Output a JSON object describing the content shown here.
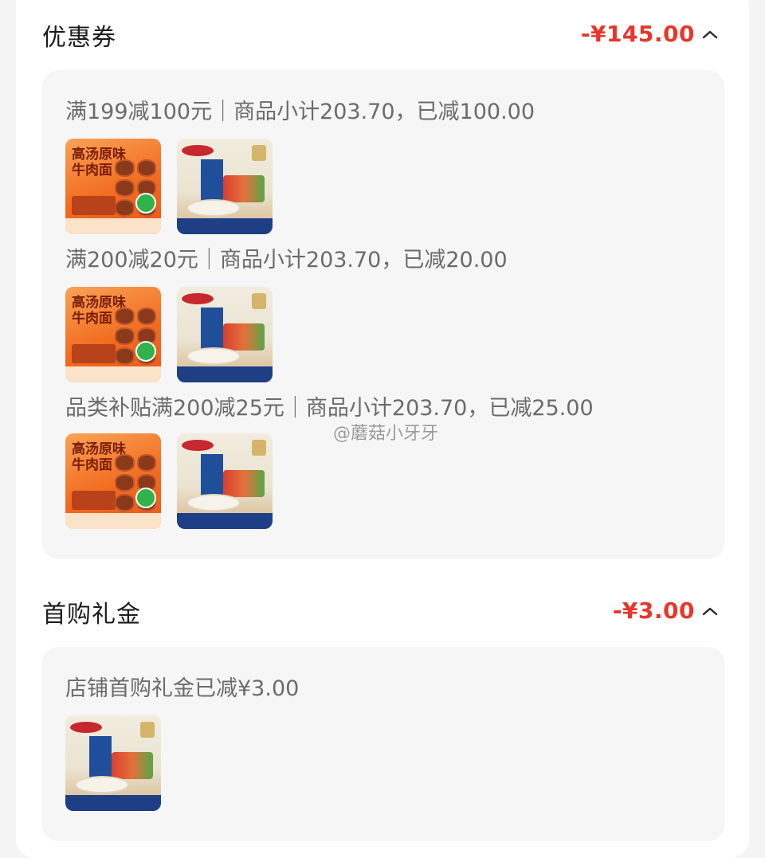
{
  "coupon": {
    "title": "优惠券",
    "amount": "-¥145.00",
    "rules": [
      "满199减100元｜商品小计203.70，已减100.00",
      "满200减20元｜商品小计203.70，已减20.00",
      "品类补贴满200减25元｜商品小计203.70，已减25.00"
    ]
  },
  "first_purchase": {
    "title": "首购礼金",
    "amount": "-¥3.00",
    "rule": "店铺首购礼金已减¥3.00"
  },
  "products": {
    "beef_noodle": "高汤原味牛肉面",
    "pasta": "Barilla"
  },
  "watermark": "@蘑菇小牙牙",
  "colors": {
    "accent": "#e8362a"
  }
}
